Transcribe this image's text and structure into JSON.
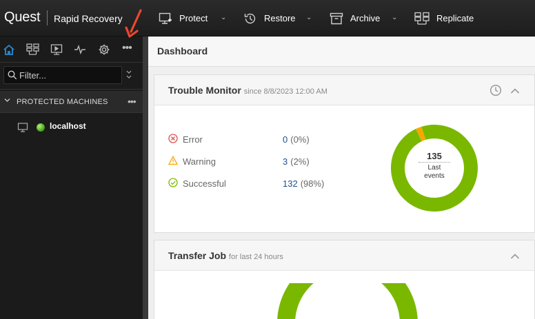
{
  "brand": {
    "logo": "Quest",
    "product": "Rapid Recovery"
  },
  "nav": [
    {
      "label": "Protect",
      "icon": "protect-icon"
    },
    {
      "label": "Restore",
      "icon": "restore-icon"
    },
    {
      "label": "Archive",
      "icon": "archive-icon"
    },
    {
      "label": "Replicate",
      "icon": "replicate-icon"
    }
  ],
  "sidebar": {
    "icons": [
      "home-icon",
      "servers-icon",
      "monitor-icon",
      "activity-icon",
      "settings-icon",
      "more-icon"
    ],
    "filter_placeholder": "Filter...",
    "section_title": "PROTECTED MACHINES",
    "machines": [
      {
        "name": "localhost",
        "status": "online"
      }
    ]
  },
  "main": {
    "title": "Dashboard",
    "trouble_monitor": {
      "title": "Trouble Monitor",
      "subtitle": "since 8/8/2023 12:00 AM",
      "rows": [
        {
          "label": "Error",
          "value": "0",
          "percent": "(0%)",
          "icon": "error-icon"
        },
        {
          "label": "Warning",
          "value": "3",
          "percent": "(2%)",
          "icon": "warning-icon"
        },
        {
          "label": "Successful",
          "value": "132",
          "percent": "(98%)",
          "icon": "success-icon"
        }
      ],
      "donut": {
        "total": "135",
        "caption_line1": "Last",
        "caption_line2": "events",
        "segments": [
          {
            "name": "Successful",
            "count": 132,
            "color": "#7ab800"
          },
          {
            "name": "Warning",
            "count": 3,
            "color": "#f5a800"
          },
          {
            "name": "Error",
            "count": 0,
            "color": "#d9534f"
          }
        ]
      }
    },
    "transfer_job": {
      "title": "Transfer Job",
      "subtitle": "for last 24 hours"
    }
  },
  "colors": {
    "accent": "#2a8cd6",
    "success": "#7ab800",
    "warning": "#f5a800",
    "error": "#d9534f",
    "annotation": "#e8482f"
  }
}
